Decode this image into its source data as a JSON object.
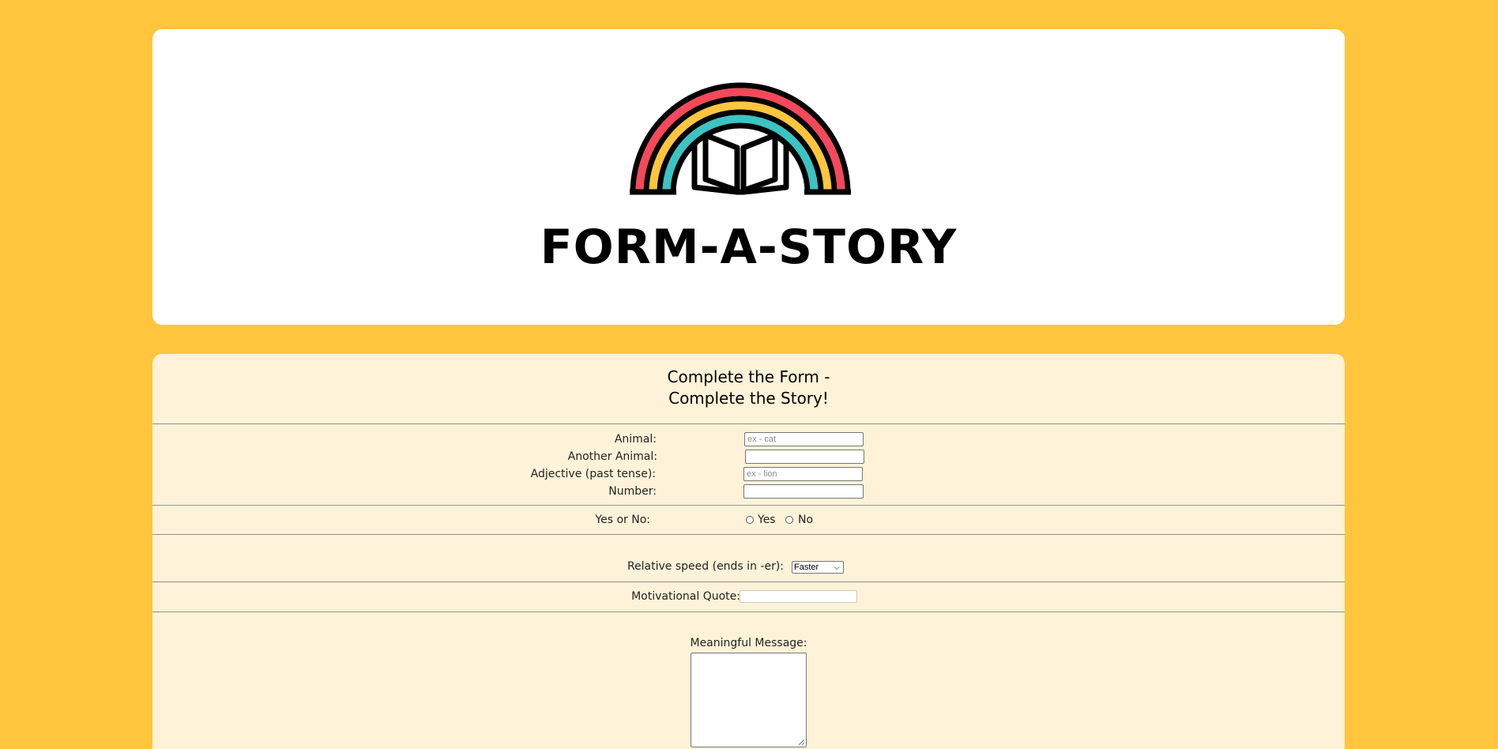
{
  "colors": {
    "page_background": "#FFC53D",
    "header_card": "#FFFFFF",
    "form_card": "#FEF3D8",
    "rainbow_red": "#F5485A",
    "rainbow_yellow": "#FFC53D",
    "rainbow_teal": "#3CC3C3"
  },
  "header": {
    "logo_title": "FORM-A-STORY",
    "logo_icon": "rainbow-book-icon"
  },
  "form": {
    "heading_line1": "Complete the Form -",
    "heading_line2": "Complete the Story!",
    "fields": {
      "animal": {
        "label": "Animal:",
        "placeholder": "ex - cat",
        "value": ""
      },
      "another_animal": {
        "label": "Another Animal:",
        "placeholder": "",
        "value": ""
      },
      "adjective": {
        "label": "Adjective (past tense):",
        "placeholder": "ex - lion",
        "value": ""
      },
      "number": {
        "label": "Number:",
        "placeholder": "",
        "value": ""
      }
    },
    "yes_no": {
      "label": "Yes or No:",
      "options": [
        "Yes",
        "No"
      ]
    },
    "relative_speed": {
      "label": "Relative speed (ends in -er):",
      "selected": "Faster"
    },
    "motivational_quote": {
      "label": "Motivational Quote:",
      "value": ""
    },
    "meaningful_message": {
      "label": "Meaningful Message:",
      "value": ""
    }
  }
}
